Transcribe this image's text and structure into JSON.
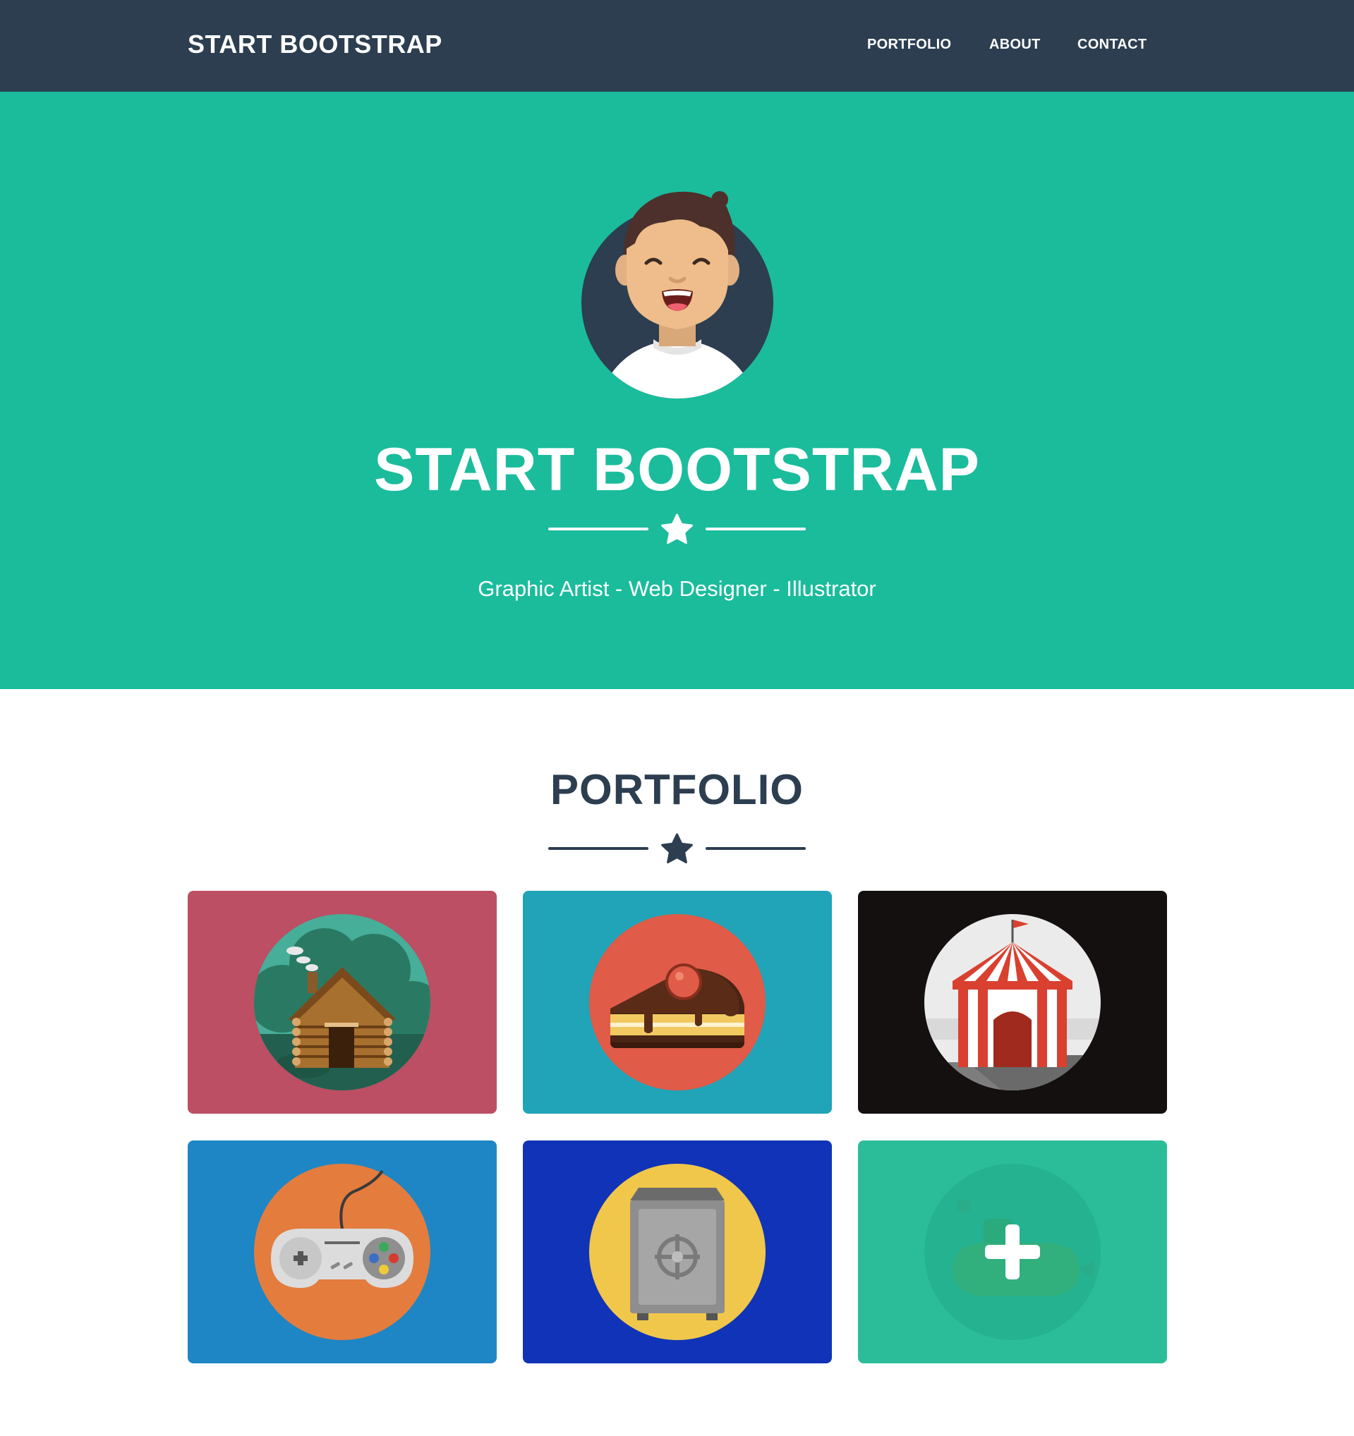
{
  "navbar": {
    "brand": "START BOOTSTRAP",
    "links": [
      "PORTFOLIO",
      "ABOUT",
      "CONTACT"
    ]
  },
  "hero": {
    "title": "START BOOTSTRAP",
    "subtitle": "Graphic Artist - Web Designer - Illustrator"
  },
  "portfolio": {
    "title": "PORTFOLIO",
    "items": [
      {
        "icon": "cabin-icon",
        "bg": "#bc4f63"
      },
      {
        "icon": "cake-icon",
        "bg": "#21a3b8"
      },
      {
        "icon": "circus-icon",
        "bg": "#14100f"
      },
      {
        "icon": "game-controller-icon",
        "bg": "#1e86c4"
      },
      {
        "icon": "safe-icon",
        "bg": "#1033b8"
      },
      {
        "icon": "submarine-icon",
        "bg": "#2bbd99"
      }
    ]
  },
  "colors": {
    "navbar": "#2c3e50",
    "hero": "#1abc9c",
    "heading": "#2c3e50"
  }
}
